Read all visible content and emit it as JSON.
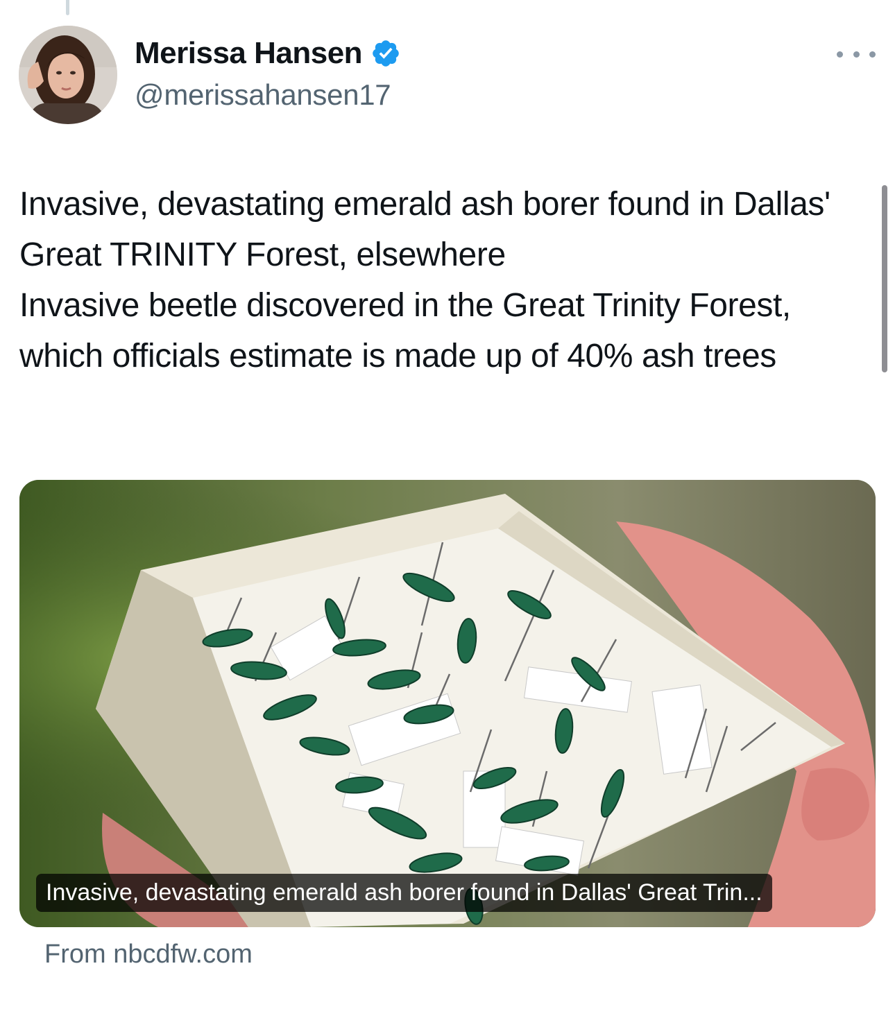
{
  "author": {
    "display_name": "Merissa Hansen",
    "handle": "@merissahansen17",
    "verified": true,
    "verified_color": "#1d9bf0"
  },
  "tweet": {
    "lines": [
      "Invasive, devastating emerald ash borer found in Dallas' Great TRINITY Forest, elsewhere",
      "Invasive beetle discovered in the Great Trinity Forest, which officials estimate is made up of 40% ash trees"
    ]
  },
  "link_card": {
    "image_subject": "box of pinned emerald ash borer beetle specimens held in hand",
    "title": "Invasive, devastating emerald ash borer found in Dallas' Great Trin...",
    "source": "From nbcdfw.com"
  },
  "icons": {
    "more": "more-horizontal-icon",
    "verified": "verified-badge-icon"
  },
  "colors": {
    "text_primary": "#0f1419",
    "text_secondary": "#536471",
    "verified_blue": "#1d9bf0"
  }
}
